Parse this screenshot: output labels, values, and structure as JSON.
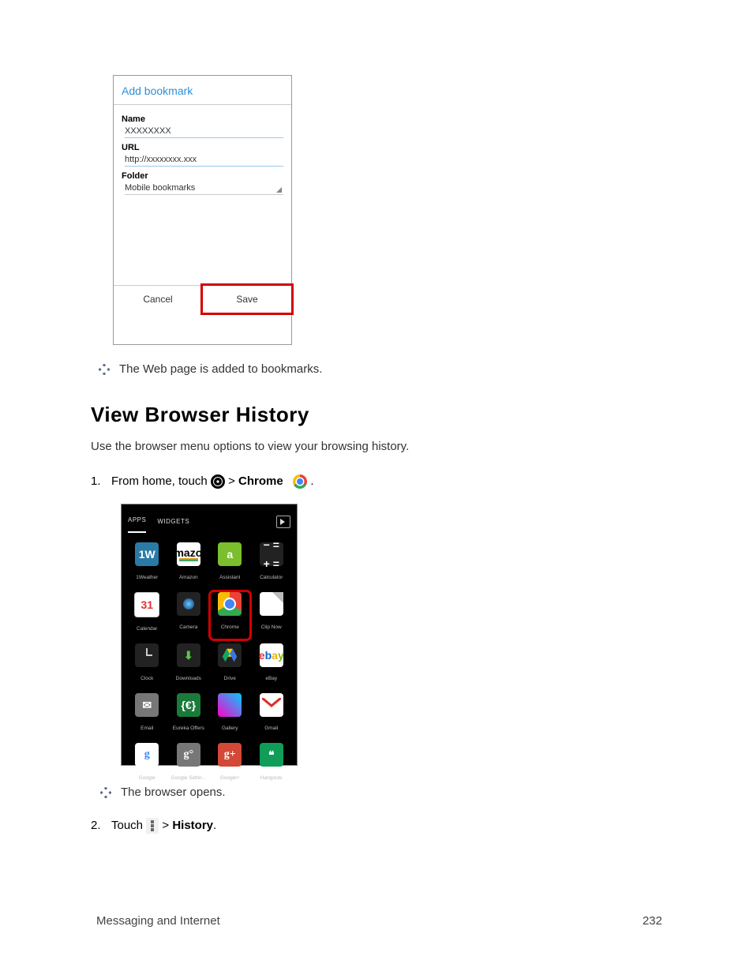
{
  "bookmark_panel": {
    "title": "Add bookmark",
    "name_label": "Name",
    "name_value": "XXXXXXXX",
    "url_label": "URL",
    "url_value": "http://xxxxxxxx.xxx",
    "folder_label": "Folder",
    "folder_value": "Mobile bookmarks",
    "cancel": "Cancel",
    "save": "Save"
  },
  "note_added": "The Web page is added to bookmarks.",
  "heading": "View Browser History",
  "intro": "Use the browser menu options to view your browsing history.",
  "step1": {
    "pre": "From home, touch ",
    "gt": " > ",
    "bold": "Chrome",
    "period": "."
  },
  "apps_panel": {
    "tab_apps": "APPS",
    "tab_widgets": "WIDGETS",
    "apps": [
      {
        "name": "1Weather"
      },
      {
        "name": "Amazon"
      },
      {
        "name": "Assistant"
      },
      {
        "name": "Calculator"
      },
      {
        "name": "Calendar"
      },
      {
        "name": "Camera"
      },
      {
        "name": "Chrome"
      },
      {
        "name": "Clip Now"
      },
      {
        "name": "Clock"
      },
      {
        "name": "Downloads"
      },
      {
        "name": "Drive"
      },
      {
        "name": "eBay"
      },
      {
        "name": "Email"
      },
      {
        "name": "Eureka Offers"
      },
      {
        "name": "Gallery"
      },
      {
        "name": "Gmail"
      },
      {
        "name": "Google"
      },
      {
        "name": "Google Settin..."
      },
      {
        "name": "Google+"
      },
      {
        "name": "Hangouts"
      }
    ]
  },
  "note_opens": "The browser opens.",
  "step2": {
    "pre": "Touch ",
    "gt": "  > ",
    "bold": "History",
    "period": "."
  },
  "footer": {
    "section": "Messaging and Internet",
    "page": "232"
  }
}
